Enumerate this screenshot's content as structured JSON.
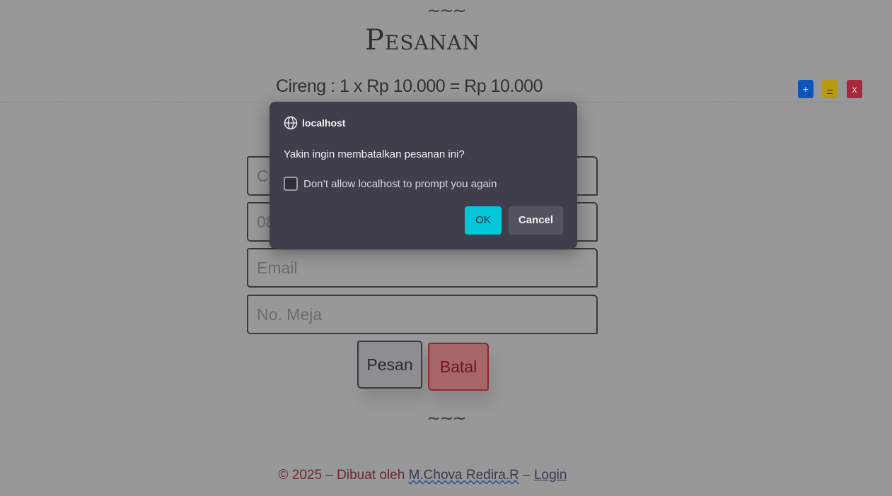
{
  "header": {
    "decor_top": "~~~",
    "title": "Pesanan"
  },
  "order": {
    "line": "Cireng : 1 x Rp 10.000 = Rp 10.000",
    "plus_label": "+",
    "minus_label": "–",
    "remove_label": "x"
  },
  "form": {
    "name_value": "Ch",
    "phone_value": "08",
    "email_placeholder": "Email",
    "table_placeholder": "No. Meja",
    "submit_label": "Pesan",
    "cancel_label": "Batal"
  },
  "footer": {
    "decor_bottom": "~~~",
    "copyright": "© 2025 – Dibuat oleh ",
    "author": "M.Chova Redira.R",
    "separator": " – ",
    "login": "Login"
  },
  "dialog": {
    "origin": "localhost",
    "message": "Yakin ingin membatalkan pesanan ini?",
    "checkbox_label": "Don’t allow localhost to prompt you again",
    "ok_label": "OK",
    "cancel_label": "Cancel"
  }
}
